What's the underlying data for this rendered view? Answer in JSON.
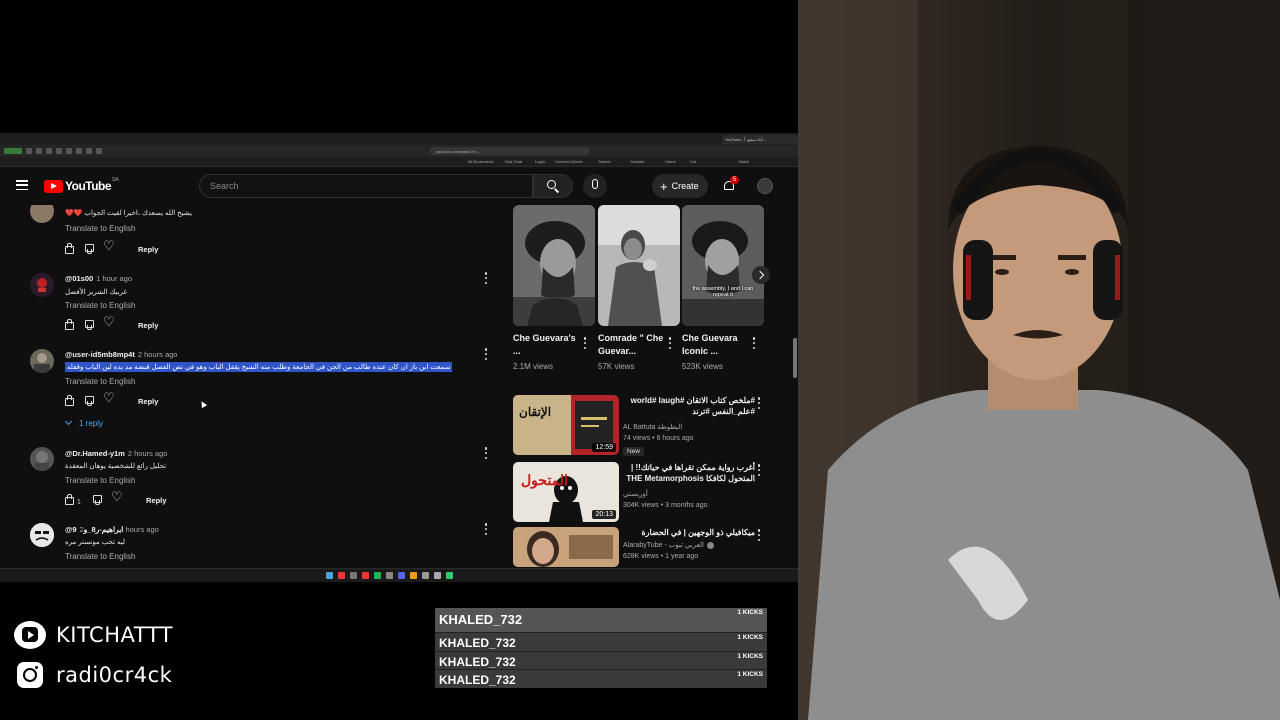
{
  "browser": {
    "active_tab_title": "YouTube - أداء سعود أ...",
    "url": "youtube.com/watch?v=...",
    "bookmarks": [
      "All Bookmarks",
      "Kick Chat",
      "Login",
      "Connect Words",
      "Search",
      "Youtube",
      "Home",
      "Cal",
      "Twitch"
    ]
  },
  "youtube": {
    "logo_text": "YouTube",
    "region": "SA",
    "search_placeholder": "Search",
    "create_label": "Create",
    "notifications_count": "5"
  },
  "comments": [
    {
      "author": "",
      "time": "",
      "text": "يشيخ الله يسعدك ،اخيرا لقيت الجواب ❤️❤️",
      "translate": "Translate to English",
      "reply": "Reply"
    },
    {
      "author": "@01s00",
      "time": "1 hour ago",
      "text": "غريبك الشرير الأفضل",
      "translate": "Translate to English",
      "reply": "Reply"
    },
    {
      "author": "@user-id5mb8mp4t",
      "time": "2 hours ago",
      "text": "سمعت ابن باز ان كان عنده طالب من الجن في الجامعة وطلب منه الشيخ يقفل الباب وهو في نص الفصل قبضة مد يده لين الباب وقفله",
      "translate": "Translate to English",
      "reply": "Reply",
      "replies_label": "1 reply"
    },
    {
      "author": "@Dr.Hamed-y1m",
      "time": "2 hours ago",
      "text": "تحليل رائع للشخصية يوهان المعقدة",
      "translate": "Translate to English",
      "likes": "1",
      "reply": "Reply"
    },
    {
      "author": "@ابراهيم-ر8_و9",
      "time": "2 hours ago",
      "text": "ليه تحب مونستر مره",
      "translate": "Translate to English"
    }
  ],
  "shorts": [
    {
      "title": "Che Guevara's ...",
      "views": "2.1M views",
      "overlay": ""
    },
    {
      "title": "Comrade \" Che Guevar...",
      "views": "57K views",
      "overlay": ""
    },
    {
      "title": "Che Guevara Iconic ...",
      "views": "523K views",
      "overlay": "the assembly, I and I can repeat it"
    }
  ],
  "videos": [
    {
      "title": "#ملخص كتاب الاتقان #world# laugh #علم_النفس #ترند",
      "channel": "AL Battuta البطوطة",
      "meta": "74 views • 6 hours ago",
      "badge": "New",
      "duration": "12:59",
      "thumb_text": "الإتقان"
    },
    {
      "title": "أغرب رواية ممكن تقراها في حياتك!! | المتحول لكافكا THE Metamorphosis",
      "channel": "أوريستي",
      "meta": "304K views • 3 months ago",
      "duration": "20:13",
      "thumb_text": "المتحول"
    },
    {
      "title": "ميكافيلي ذو الوجهين | في الحضارة",
      "channel": "AlarabyTube - العربي تيوب",
      "meta": "628K views • 1 year ago",
      "duration": ""
    }
  ],
  "social": {
    "youtube_handle": "KITCHATTT",
    "instagram_handle": "radi0cr4ck"
  },
  "kicks": [
    {
      "name": "KHALED_732",
      "count": "1 KICKS"
    },
    {
      "name": "KHALED_732",
      "count": "1 KICKS"
    },
    {
      "name": "KHALED_732",
      "count": "1 KICKS"
    },
    {
      "name": "KHALED_732",
      "count": "1 KICKS"
    }
  ],
  "colors": {
    "youtube_red": "#ff0000",
    "highlight": "#2f55c8",
    "link_blue": "#3ea6ff",
    "page_bg": "#0f0f0f"
  }
}
